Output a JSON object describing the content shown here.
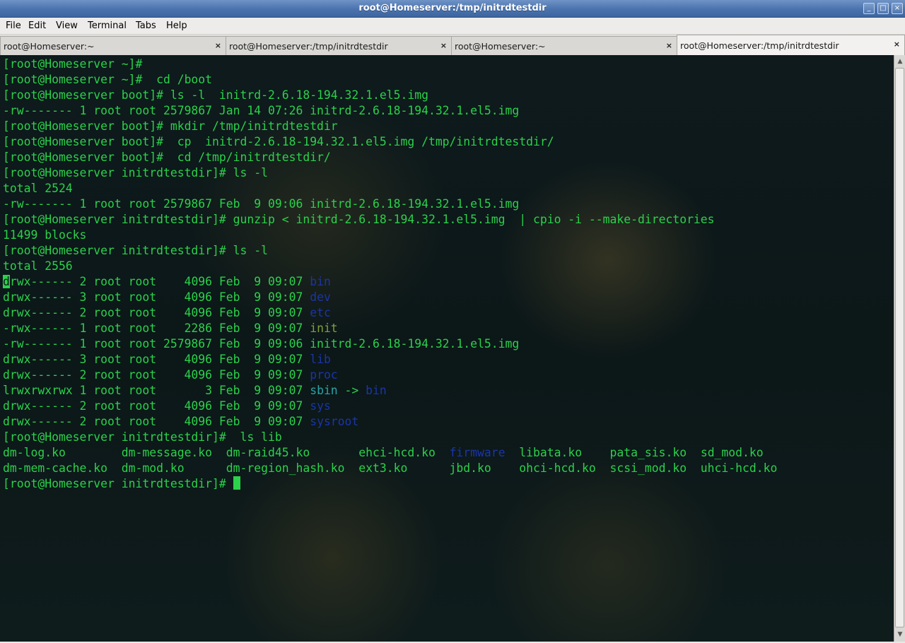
{
  "window": {
    "title": "root@Homeserver:/tmp/initrdtestdir",
    "minimize_glyph": "_",
    "maximize_glyph": "□",
    "close_glyph": "×"
  },
  "menubar": {
    "items": [
      "File",
      "Edit",
      "View",
      "Terminal",
      "Tabs",
      "Help"
    ]
  },
  "tabs": [
    {
      "label": "root@Homeserver:~",
      "close": "×",
      "active": false
    },
    {
      "label": "root@Homeserver:/tmp/initrdtestdir",
      "close": "×",
      "active": false
    },
    {
      "label": "root@Homeserver:~",
      "close": "×",
      "active": false
    },
    {
      "label": "root@Homeserver:/tmp/initrdtestdir",
      "close": "×",
      "active": true
    }
  ],
  "colors": {
    "terminal_fg": "#2bd14b",
    "directory": "#1a35a8",
    "symlink": "#2aa4a6",
    "executable": "#7ea03a",
    "titlebar": "#4a72ad"
  },
  "terminal": {
    "lines": [
      [
        {
          "t": "[root@Homeserver ~]#",
          "c": "green"
        }
      ],
      [
        {
          "t": "[root@Homeserver ~]#  cd /boot",
          "c": "green"
        }
      ],
      [
        {
          "t": "[root@Homeserver boot]# ls -l  initrd-2.6.18-194.32.1.el5.img",
          "c": "green"
        }
      ],
      [
        {
          "t": "-rw------- 1 root root 2579867 Jan 14 07:26 initrd-2.6.18-194.32.1.el5.img",
          "c": "green"
        }
      ],
      [
        {
          "t": "[root@Homeserver boot]# mkdir /tmp/initrdtestdir",
          "c": "green"
        }
      ],
      [
        {
          "t": "[root@Homeserver boot]#  cp  initrd-2.6.18-194.32.1.el5.img /tmp/initrdtestdir/",
          "c": "green"
        }
      ],
      [
        {
          "t": "[root@Homeserver boot]#  cd /tmp/initrdtestdir/",
          "c": "green"
        }
      ],
      [
        {
          "t": "[root@Homeserver initrdtestdir]# ls -l",
          "c": "green"
        }
      ],
      [
        {
          "t": "total 2524",
          "c": "green"
        }
      ],
      [
        {
          "t": "-rw------- 1 root root 2579867 Feb  9 09:06 initrd-2.6.18-194.32.1.el5.img",
          "c": "green"
        }
      ],
      [
        {
          "t": "[root@Homeserver initrdtestdir]# gunzip < initrd-2.6.18-194.32.1.el5.img  | cpio -i --make-directories",
          "c": "green"
        }
      ],
      [
        {
          "t": "11499 blocks",
          "c": "green"
        }
      ],
      [
        {
          "t": "[root@Homeserver initrdtestdir]# ls -l",
          "c": "green"
        }
      ],
      [
        {
          "t": "total 2556",
          "c": "green"
        }
      ],
      [
        {
          "t": "d",
          "c": "hl"
        },
        {
          "t": "rwx------ 2 root root    4096 Feb  9 09:07 ",
          "c": "green"
        },
        {
          "t": "bin",
          "c": "blue"
        }
      ],
      [
        {
          "t": "drwx------ 3 root root    4096 Feb  9 09:07 ",
          "c": "green"
        },
        {
          "t": "dev",
          "c": "blue"
        }
      ],
      [
        {
          "t": "drwx------ 2 root root    4096 Feb  9 09:07 ",
          "c": "green"
        },
        {
          "t": "etc",
          "c": "blue"
        }
      ],
      [
        {
          "t": "-rwx------ 1 root root    2286 Feb  9 09:07 ",
          "c": "green"
        },
        {
          "t": "init",
          "c": "gray"
        }
      ],
      [
        {
          "t": "-rw------- 1 root root 2579867 Feb  9 09:06 initrd-2.6.18-194.32.1.el5.img",
          "c": "green"
        }
      ],
      [
        {
          "t": "drwx------ 3 root root    4096 Feb  9 09:07 ",
          "c": "green"
        },
        {
          "t": "lib",
          "c": "blue"
        }
      ],
      [
        {
          "t": "drwx------ 2 root root    4096 Feb  9 09:07 ",
          "c": "green"
        },
        {
          "t": "proc",
          "c": "blue"
        }
      ],
      [
        {
          "t": "lrwxrwxrwx 1 root root       3 Feb  9 09:07 ",
          "c": "green"
        },
        {
          "t": "sbin",
          "c": "cyan"
        },
        {
          "t": " -> ",
          "c": "green"
        },
        {
          "t": "bin",
          "c": "blue"
        }
      ],
      [
        {
          "t": "drwx------ 2 root root    4096 Feb  9 09:07 ",
          "c": "green"
        },
        {
          "t": "sys",
          "c": "blue"
        }
      ],
      [
        {
          "t": "drwx------ 2 root root    4096 Feb  9 09:07 ",
          "c": "green"
        },
        {
          "t": "sysroot",
          "c": "blue"
        }
      ],
      [
        {
          "t": "[root@Homeserver initrdtestdir]#  ls lib",
          "c": "green"
        }
      ],
      [
        {
          "t": "dm-log.ko        dm-message.ko  dm-raid45.ko       ehci-hcd.ko  ",
          "c": "green"
        },
        {
          "t": "firmware",
          "c": "blue"
        },
        {
          "t": "  libata.ko    pata_sis.ko  sd_mod.ko",
          "c": "green"
        }
      ],
      [
        {
          "t": "dm-mem-cache.ko  dm-mod.ko      dm-region_hash.ko  ext3.ko      jbd.ko    ohci-hcd.ko  scsi_mod.ko  uhci-hcd.ko",
          "c": "green"
        }
      ],
      [
        {
          "t": "[root@Homeserver initrdtestdir]# ",
          "c": "green"
        },
        {
          "t": "",
          "c": "cursor"
        }
      ]
    ]
  }
}
